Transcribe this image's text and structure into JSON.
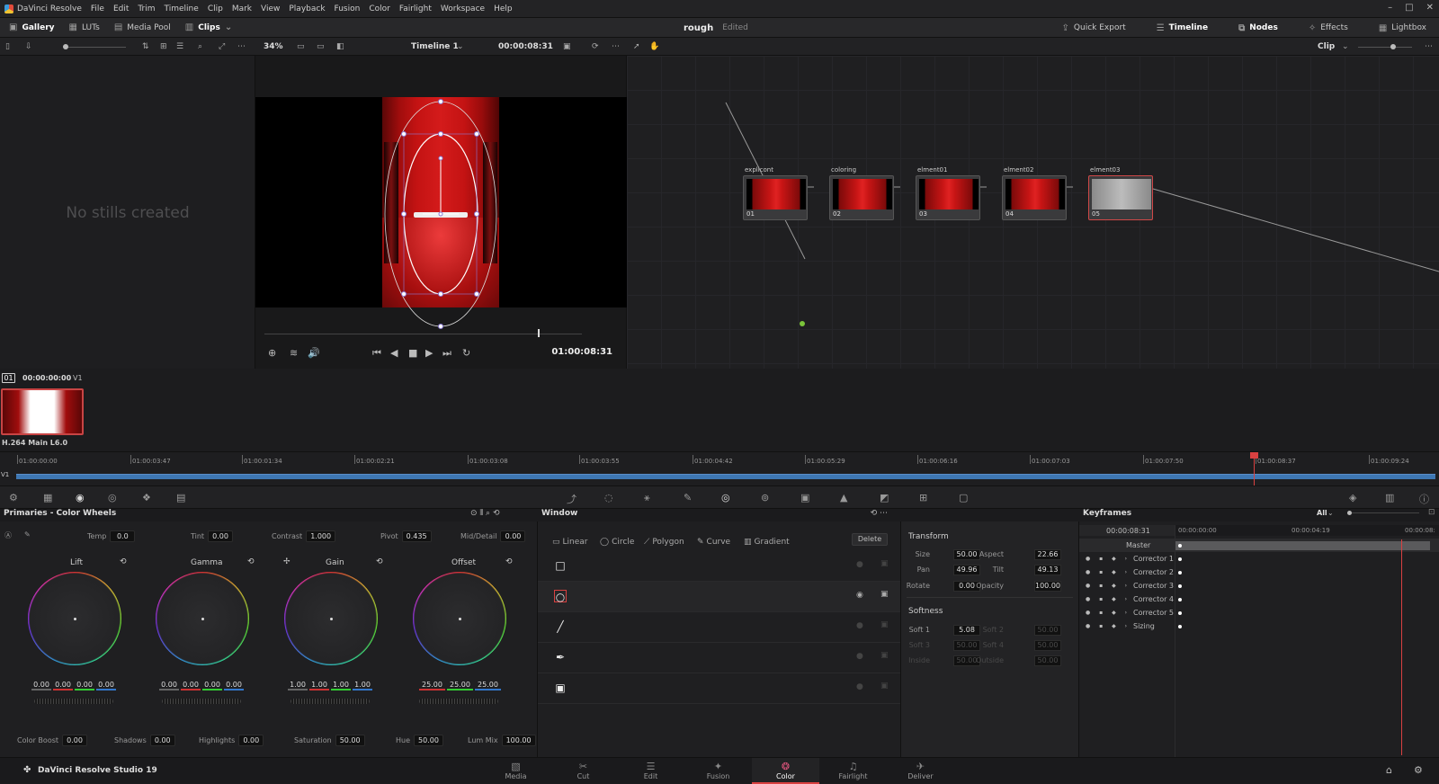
{
  "app": {
    "title": "DaVinci Resolve",
    "brand": "DaVinci Resolve Studio 19"
  },
  "menu": [
    "File",
    "Edit",
    "Trim",
    "Timeline",
    "Clip",
    "Mark",
    "View",
    "Playback",
    "Fusion",
    "Color",
    "Fairlight",
    "Workspace",
    "Help"
  ],
  "toolbar": {
    "left": [
      "Gallery",
      "LUTs",
      "Media Pool",
      "Clips"
    ],
    "project_name": "rough",
    "project_status": "Edited",
    "right": [
      "Quick Export",
      "Timeline",
      "Nodes",
      "Effects",
      "Lightbox"
    ]
  },
  "viewer": {
    "zoom": "34%",
    "timeline_name": "Timeline 1",
    "timecode": "00:00:08:31",
    "current_tc": "01:00:08:31",
    "node_mode": "Clip",
    "playhead_fraction": 0.86
  },
  "gallery": {
    "empty_text": "No stills created"
  },
  "nodes": [
    {
      "label": "explicont",
      "num": "01"
    },
    {
      "label": "coloring",
      "num": "02"
    },
    {
      "label": "elment01",
      "num": "03"
    },
    {
      "label": "elment02",
      "num": "04"
    },
    {
      "label": "elment03",
      "num": "05"
    }
  ],
  "clip": {
    "number": "01",
    "timecode": "00:00:00:00",
    "track": "V1",
    "codec": "H.264 Main L6.0"
  },
  "timeline_ruler": {
    "ticks": [
      "01:00:00:00",
      "01:00:03:47",
      "01:00:01:34",
      "01:00:02:21",
      "01:00:03:08",
      "01:00:03:55",
      "01:00:04:42",
      "01:00:05:29",
      "01:00:06:16",
      "01:00:07:03",
      "01:00:07:50",
      "01:00:08:37",
      "01:00:09:24"
    ],
    "track": "V1"
  },
  "primaries": {
    "title": "Primaries - Color Wheels",
    "top": [
      {
        "label": "Temp",
        "value": "0.0"
      },
      {
        "label": "Tint",
        "value": "0.00"
      },
      {
        "label": "Contrast",
        "value": "1.000"
      },
      {
        "label": "Pivot",
        "value": "0.435"
      },
      {
        "label": "Mid/Detail",
        "value": "0.00"
      }
    ],
    "wheels": [
      {
        "name": "Lift",
        "values": [
          "0.00",
          "0.00",
          "0.00",
          "0.00"
        ]
      },
      {
        "name": "Gamma",
        "values": [
          "0.00",
          "0.00",
          "0.00",
          "0.00"
        ]
      },
      {
        "name": "Gain",
        "values": [
          "1.00",
          "1.00",
          "1.00",
          "1.00"
        ]
      },
      {
        "name": "Offset",
        "values": [
          "25.00",
          "25.00",
          "25.00"
        ]
      }
    ],
    "bottom": [
      {
        "label": "Color Boost",
        "value": "0.00"
      },
      {
        "label": "Shadows",
        "value": "0.00"
      },
      {
        "label": "Highlights",
        "value": "0.00"
      },
      {
        "label": "Saturation",
        "value": "50.00"
      },
      {
        "label": "Hue",
        "value": "50.00"
      },
      {
        "label": "Lum Mix",
        "value": "100.00"
      }
    ]
  },
  "window_panel": {
    "title": "Window",
    "tabs": [
      "Linear",
      "Circle",
      "Polygon",
      "Curve",
      "Gradient"
    ],
    "delete_label": "Delete"
  },
  "transform": {
    "title": "Transform",
    "rows": [
      {
        "l1": "Size",
        "v1": "50.00",
        "l2": "Aspect",
        "v2": "22.66"
      },
      {
        "l1": "Pan",
        "v1": "49.96",
        "l2": "Tilt",
        "v2": "49.13"
      },
      {
        "l1": "Rotate",
        "v1": "0.00",
        "l2": "Opacity",
        "v2": "100.00"
      }
    ],
    "softness_title": "Softness",
    "soft_rows": [
      {
        "l1": "Soft 1",
        "v1": "5.08",
        "l2": "Soft 2",
        "v2": "50.00"
      },
      {
        "l1": "Soft 3",
        "v1": "50.00",
        "l2": "Soft 4",
        "v2": "50.00"
      },
      {
        "l1": "Inside",
        "v1": "50.00",
        "l2": "Outside",
        "v2": "50.00"
      }
    ]
  },
  "keyframes": {
    "title": "Keyframes",
    "filter": "All",
    "tc_current": "00:00:08:31",
    "tc_start": "00:00:00:00",
    "tc_mid": "00:00:04:19",
    "tc_end": "00:00:08:",
    "master": "Master",
    "rows": [
      "Corrector 1",
      "Corrector 2",
      "Corrector 3",
      "Corrector 4",
      "Corrector 5",
      "Sizing"
    ]
  },
  "pages": [
    "Media",
    "Cut",
    "Edit",
    "Fusion",
    "Color",
    "Fairlight",
    "Deliver"
  ],
  "colors": {
    "accent": "#d94141",
    "color_page": "#e0557d",
    "track": "#3e77b3"
  }
}
